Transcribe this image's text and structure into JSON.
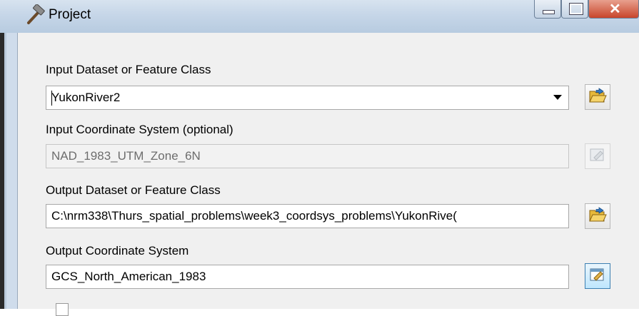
{
  "window": {
    "title": "Project"
  },
  "form": {
    "input_dataset": {
      "label": "Input Dataset or Feature Class",
      "value": "YukonRiver2"
    },
    "input_coord": {
      "label": "Input Coordinate System (optional)",
      "value": "NAD_1983_UTM_Zone_6N"
    },
    "output_dataset": {
      "label": "Output Dataset or Feature Class",
      "value": "C:\\nrm338\\Thurs_spatial_problems\\week3_coordsys_problems\\YukonRive("
    },
    "output_coord": {
      "label": "Output Coordinate System",
      "value": "GCS_North_American_1983"
    }
  },
  "icons": {
    "title": "hammer-icon",
    "browse": "folder-open-icon",
    "coord_props": "coordinate-properties-icon",
    "dropdown": "chevron-down-icon"
  },
  "colors": {
    "titlebar": "#c6d6e8",
    "close_button": "#c8452b",
    "content_bg": "#f0f0f0"
  }
}
